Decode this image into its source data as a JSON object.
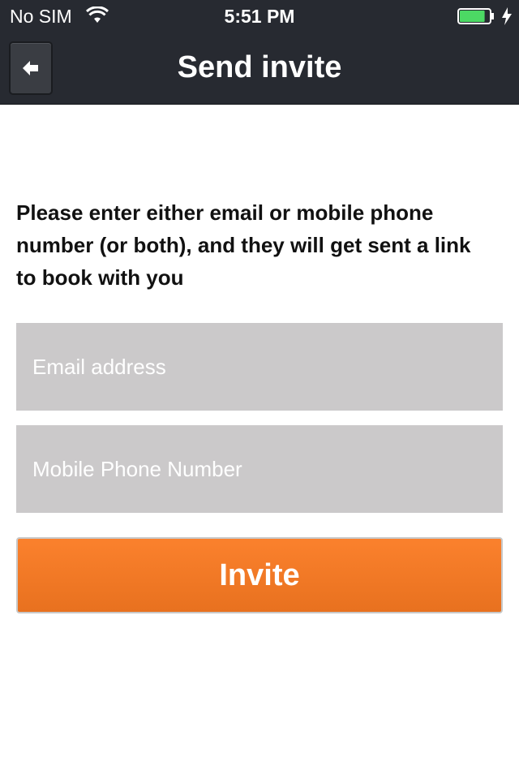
{
  "status_bar": {
    "carrier": "No SIM",
    "time": "5:51 PM",
    "battery_level": 0.85,
    "battery_color": "#4cd964"
  },
  "nav": {
    "title": "Send invite",
    "back_icon": "arrow-left-icon"
  },
  "main": {
    "instructions": "Please enter either email or mobile phone number (or both), and they will get sent a link to book with you",
    "email_field": {
      "value": "",
      "placeholder": "Email address"
    },
    "phone_field": {
      "value": "",
      "placeholder": "Mobile Phone Number"
    },
    "invite_label": "Invite",
    "accent_color": "#f57a26"
  }
}
